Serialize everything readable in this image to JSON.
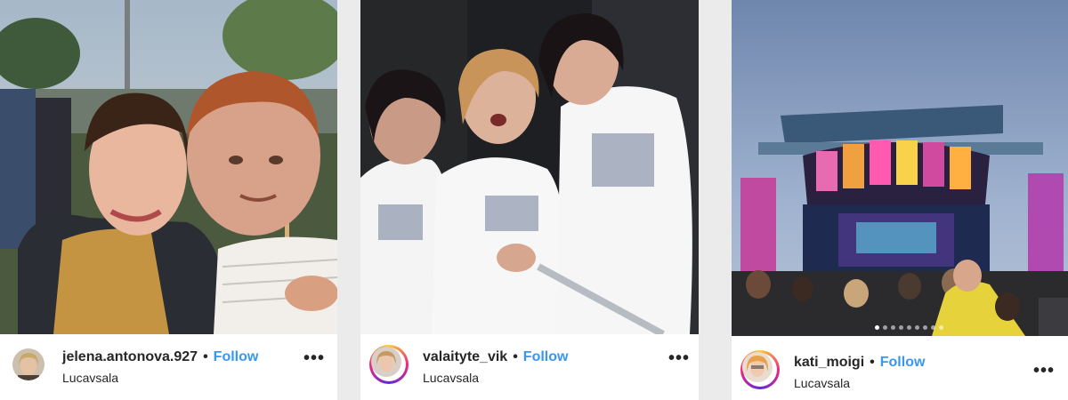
{
  "posts": [
    {
      "username": "jelena.antonova.927",
      "separator": "•",
      "follow_label": "Follow",
      "location": "Lucavsala",
      "more_label": "•••",
      "has_story_ring": false,
      "photo_desc_icon": "photo-image"
    },
    {
      "username": "valaityte_vik",
      "separator": "•",
      "follow_label": "Follow",
      "location": "Lucavsala",
      "more_label": "•••",
      "has_story_ring": true,
      "photo_desc_icon": "photo-image"
    },
    {
      "username": "kati_moigi",
      "separator": "•",
      "follow_label": "Follow",
      "location": "Lucavsala",
      "more_label": "•••",
      "has_story_ring": true,
      "carousel_count": 9,
      "carousel_active_index": 0,
      "photo_desc_icon": "photo-image"
    }
  ],
  "colors": {
    "follow": "#3897f0",
    "text": "#262626",
    "background": "#ebebeb"
  }
}
